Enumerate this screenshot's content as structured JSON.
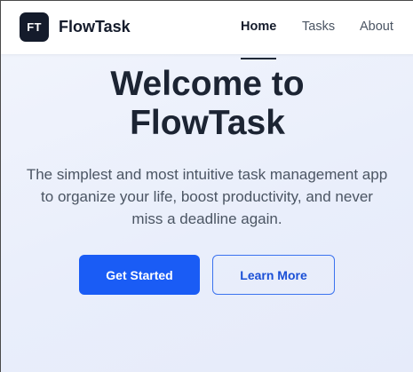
{
  "navbar": {
    "logo_text": "FT",
    "brand": "FlowTask",
    "links": [
      {
        "label": "Home",
        "active": true
      },
      {
        "label": "Tasks",
        "active": false
      },
      {
        "label": "About",
        "active": false
      }
    ]
  },
  "hero": {
    "title_line1": "Welcome to",
    "title_line2": "FlowTask",
    "subtitle_line1": "The simplest and most intuitive task management app",
    "subtitle_line2": "to organize your life, boost productivity, and never",
    "subtitle_line3": "miss a deadline again.",
    "primary_button": "Get Started",
    "secondary_button": "Learn More"
  },
  "colors": {
    "accent": "#1a5cf5",
    "dark": "#141b2b"
  }
}
